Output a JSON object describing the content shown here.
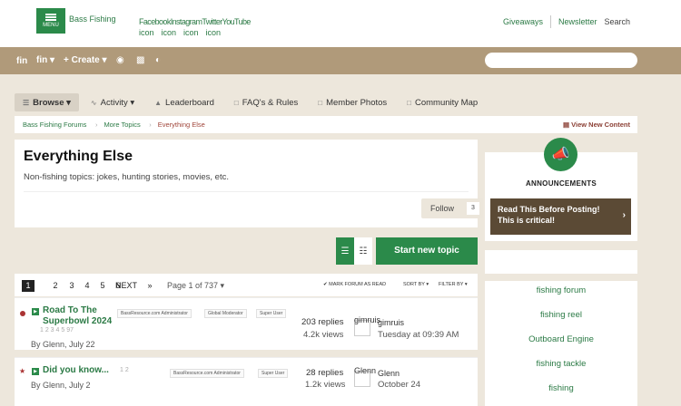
{
  "header": {
    "menu_label": "MENU",
    "brand": "Bass Fishing",
    "social_names": "FacebookInstagramTwitterYouTube",
    "social_icons": [
      "icon",
      "icon",
      "icon",
      "icon"
    ],
    "links": {
      "giveaways": "Giveaways",
      "newsletter": "Newsletter",
      "search": "Search"
    }
  },
  "navbar": {
    "logo": "fin",
    "fin_menu": "fin ▾",
    "create": "+ Create ▾"
  },
  "tabs": [
    {
      "label": "Browse ▾",
      "icon": "list-icon"
    },
    {
      "label": "Activity ▾",
      "icon": "activity-icon"
    },
    {
      "label": "Leaderboard",
      "icon": "trophy-icon"
    },
    {
      "label": "FAQ's & Rules",
      "icon": "document-icon"
    },
    {
      "label": "Member Photos",
      "icon": "document-icon"
    },
    {
      "label": "Community Map",
      "icon": "document-icon"
    }
  ],
  "breadcrumb": {
    "items": [
      "Bass Fishing Forums",
      "More Topics",
      "Everything Else"
    ],
    "view_new": "View New Content"
  },
  "forum": {
    "title": "Everything Else",
    "description": "Non-fishing topics: jokes, hunting stories, movies, etc.",
    "follow_label": "Follow",
    "follow_count": "3"
  },
  "toolbar": {
    "start_topic": "Start new topic"
  },
  "pagination": {
    "pages": [
      "1",
      "2",
      "3",
      "4",
      "5",
      "6"
    ],
    "next": "NEXT",
    "last_arrow": "»",
    "page_of": "Page 1 of 737 ▾",
    "mark_read": "✔ MARK FORUM AS READ",
    "sort_by": "SORT BY ▾",
    "filter_by": "FILTER BY ▾"
  },
  "topics": [
    {
      "title_line1": "Road To The",
      "title_line2": "Superbowl 2024",
      "badges": [
        "BassResource.com Administrator",
        "Global Moderator",
        "Super User"
      ],
      "mini_pages": "1   2   3   4   5   97",
      "by": "By Glenn, July 22",
      "replies": "203 replies",
      "views": "4.2k views",
      "avatar_name": "gimruis",
      "last_user": "gimruis",
      "last_date": "Tuesday at 09:39 AM"
    },
    {
      "title_line1": "Did you know...",
      "badges": [
        "BassResource.com Administrator",
        "Super User"
      ],
      "mini_pages": "1   2",
      "by": "By Glenn, July 2",
      "replies": "28 replies",
      "views": "1.2k views",
      "avatar_name": "Glenn",
      "last_user": "Glenn",
      "last_date": "October 24"
    }
  ],
  "sidebar": {
    "announcements_title": "ANNOUNCEMENTS",
    "announcement_line1": "Read This Before Posting!",
    "announcement_line2": "This is critical!",
    "tags": [
      "fishing forum",
      "fishing reel",
      "Outboard Engine",
      "fishing tackle",
      "fishing"
    ]
  },
  "colors": {
    "accent_green": "#2b8a4a",
    "nav_tan": "#b09a7a",
    "announcement_brown": "#5b4a35"
  }
}
